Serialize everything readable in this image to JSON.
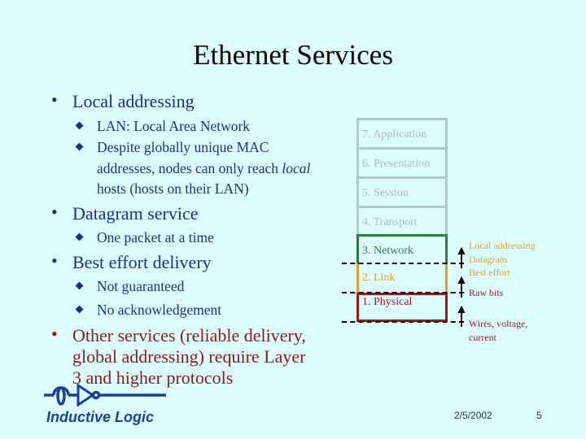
{
  "slide": {
    "title": "Ethernet Services",
    "bullets": [
      {
        "text": "Local addressing",
        "sub": [
          "LAN: Local Area Network",
          "Despite globally unique MAC addresses, nodes can only reach"
        ],
        "sub_last_italic": "local",
        "sub_last_rest": " hosts (hosts on their LAN)"
      },
      {
        "text": "Datagram service",
        "sub": [
          "One packet at a time"
        ]
      },
      {
        "text": "Best effort delivery",
        "sub": [
          "Not guaranteed",
          "No acknowledgement"
        ]
      },
      {
        "text_lines": [
          "Other services (reliable delivery,",
          "global addressing) require Layer",
          "3 and higher protocols"
        ]
      }
    ]
  },
  "osi_stack": {
    "layers": [
      {
        "label": "7. Application",
        "color": "#a8bcbc"
      },
      {
        "label": "6. Presentation",
        "color": "#a8bcbc"
      },
      {
        "label": "5. Session",
        "color": "#a8bcbc"
      },
      {
        "label": "4. Transport",
        "color": "#a8bcbc"
      },
      {
        "label": "3. Network",
        "color": "#2f7a3f"
      },
      {
        "label": "2. Link",
        "color": "#d9a030"
      },
      {
        "label": "1. Physical",
        "color": "#9a1a1a"
      }
    ],
    "annotations": {
      "link": [
        "Local addressing",
        "Datagram",
        "Best effort"
      ],
      "link_color": "#d9a030",
      "physical": "Raw bits",
      "physical_color": "#9a1a1a",
      "media": [
        "Wires, voltage,",
        "current"
      ],
      "media_color": "#9a1a1a"
    }
  },
  "footer": {
    "logo": "Inductive Logic",
    "date": "2/5/2002",
    "page": "5"
  }
}
